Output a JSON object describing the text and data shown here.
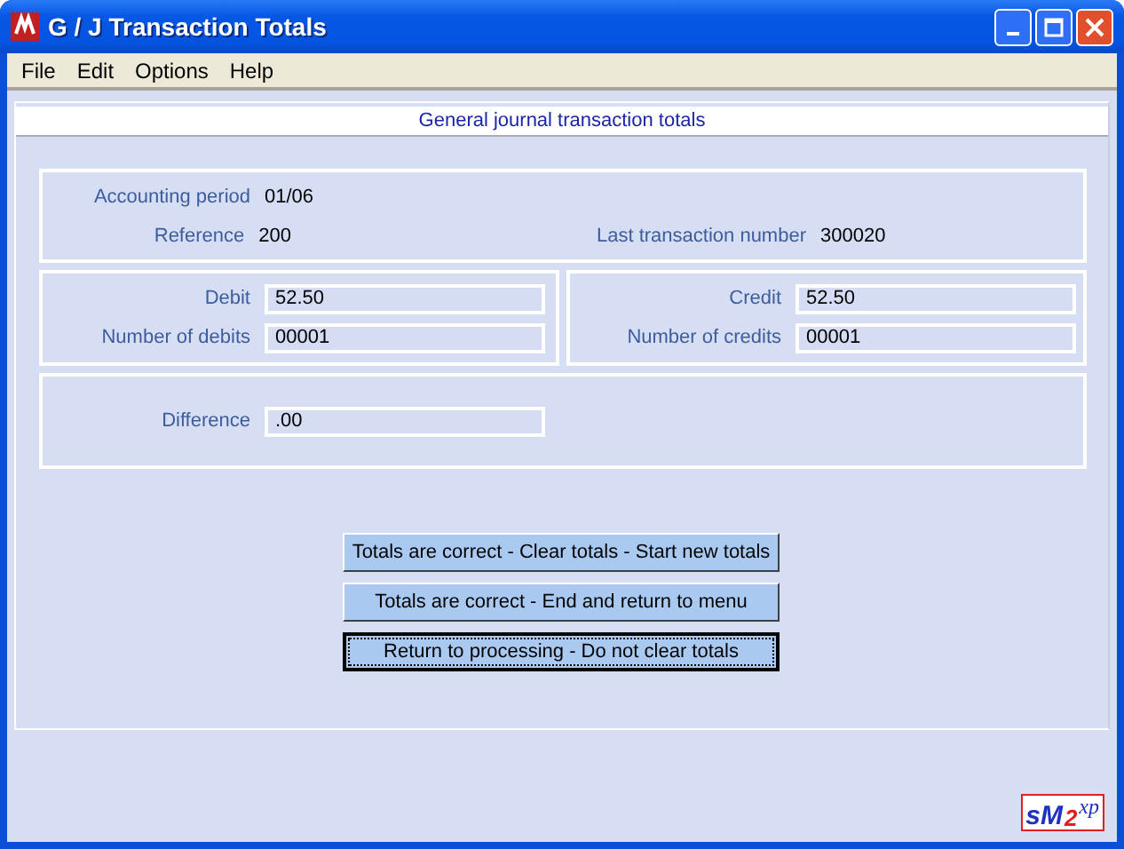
{
  "window": {
    "title": "G / J Transaction Totals"
  },
  "menu": [
    "File",
    "Edit",
    "Options",
    "Help"
  ],
  "header": "General journal transaction totals",
  "info": [
    {
      "label": "Accounting period",
      "value": "01/06"
    },
    {
      "label": "Reference",
      "value": "200"
    },
    {
      "label": "Last transaction number",
      "value": "300020"
    }
  ],
  "debits": [
    {
      "label": "Debit",
      "value": "52.50"
    },
    {
      "label": "Number of debits",
      "value": "00001"
    }
  ],
  "credits": [
    {
      "label": "Credit",
      "value": "52.50"
    },
    {
      "label": "Number of credits",
      "value": "00001"
    }
  ],
  "difference": {
    "label": "Difference",
    "value": ".00"
  },
  "buttons": [
    {
      "label": "Totals are correct - Clear totals - Start new totals",
      "focused": false
    },
    {
      "label": "Totals are correct - End and return to menu",
      "focused": false
    },
    {
      "label": "Return to processing - Do not clear totals",
      "focused": true
    }
  ],
  "logo": [
    {
      "kind": "s",
      "text": "s"
    },
    {
      "kind": "m",
      "text": "M"
    },
    {
      "kind": "two",
      "text": "2"
    },
    {
      "kind": "xp",
      "text": "xp"
    }
  ]
}
